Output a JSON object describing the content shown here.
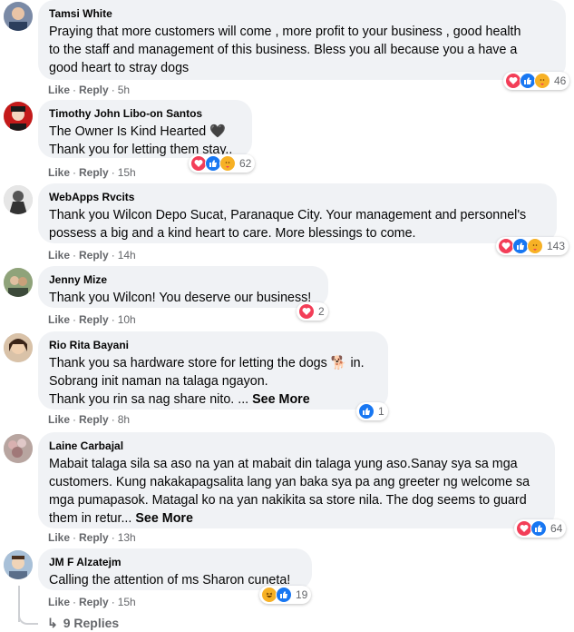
{
  "comments": [
    {
      "author": "Tamsi White",
      "text": "Praying that more customers will come , more profit to your business , good health\nto the staff and management of this business. Bless you all because you a have a\ngood heart to stray dogs",
      "see_more": "",
      "like": "Like",
      "reply": "Reply",
      "time": "5h",
      "reaction_count": "46"
    },
    {
      "author": "Timothy John Libo-on Santos",
      "text": "The Owner Is Kind Hearted 🖤\nThank you for letting them stay..",
      "see_more": "",
      "like": "Like",
      "reply": "Reply",
      "time": "15h",
      "reaction_count": "62"
    },
    {
      "author": "WebApps Rvcits",
      "text": "Thank you Wilcon Depo Sucat, Paranaque City. Your management and personnel's\npossess a big and a kind heart to care. More blessings to come.",
      "see_more": "",
      "like": "Like",
      "reply": "Reply",
      "time": "14h",
      "reaction_count": "143"
    },
    {
      "author": "Jenny Mize",
      "text": "Thank you Wilcon! You deserve our business!",
      "see_more": "",
      "like": "Like",
      "reply": "Reply",
      "time": "10h",
      "reaction_count": "2"
    },
    {
      "author": "Rio Rita Bayani",
      "text": "Thank you sa hardware store for letting the dogs 🐕 in.\nSobrang init naman na talaga ngayon.\nThank you rin sa nag share nito. ...",
      "see_more": "See More",
      "like": "Like",
      "reply": "Reply",
      "time": "8h",
      "reaction_count": "1"
    },
    {
      "author": "Laine Carbajal",
      "text": "Mabait talaga sila sa aso na yan at mabait din talaga yung aso.Sanay sya sa mga\ncustomers. Kung nakakapagsalita lang yan baka sya pa ang greeter ng welcome sa\nmga pumapasok. Matagal ko na yan nakikita sa store nila. The dog seems to guard\nthem in retur...",
      "see_more": "See More",
      "like": "Like",
      "reply": "Reply",
      "time": "13h",
      "reaction_count": "64"
    },
    {
      "author": "JM F Alzatejm",
      "text": "Calling the attention of ms Sharon cuneta!",
      "see_more": "",
      "like": "Like",
      "reply": "Reply",
      "time": "15h",
      "reaction_count": "19"
    }
  ],
  "replies_label": "9 Replies",
  "colors": {
    "bubble": "#f0f2f5",
    "love": "#f33e58",
    "like": "#1877f2",
    "care": "#f7b125",
    "meta": "#65676b"
  }
}
